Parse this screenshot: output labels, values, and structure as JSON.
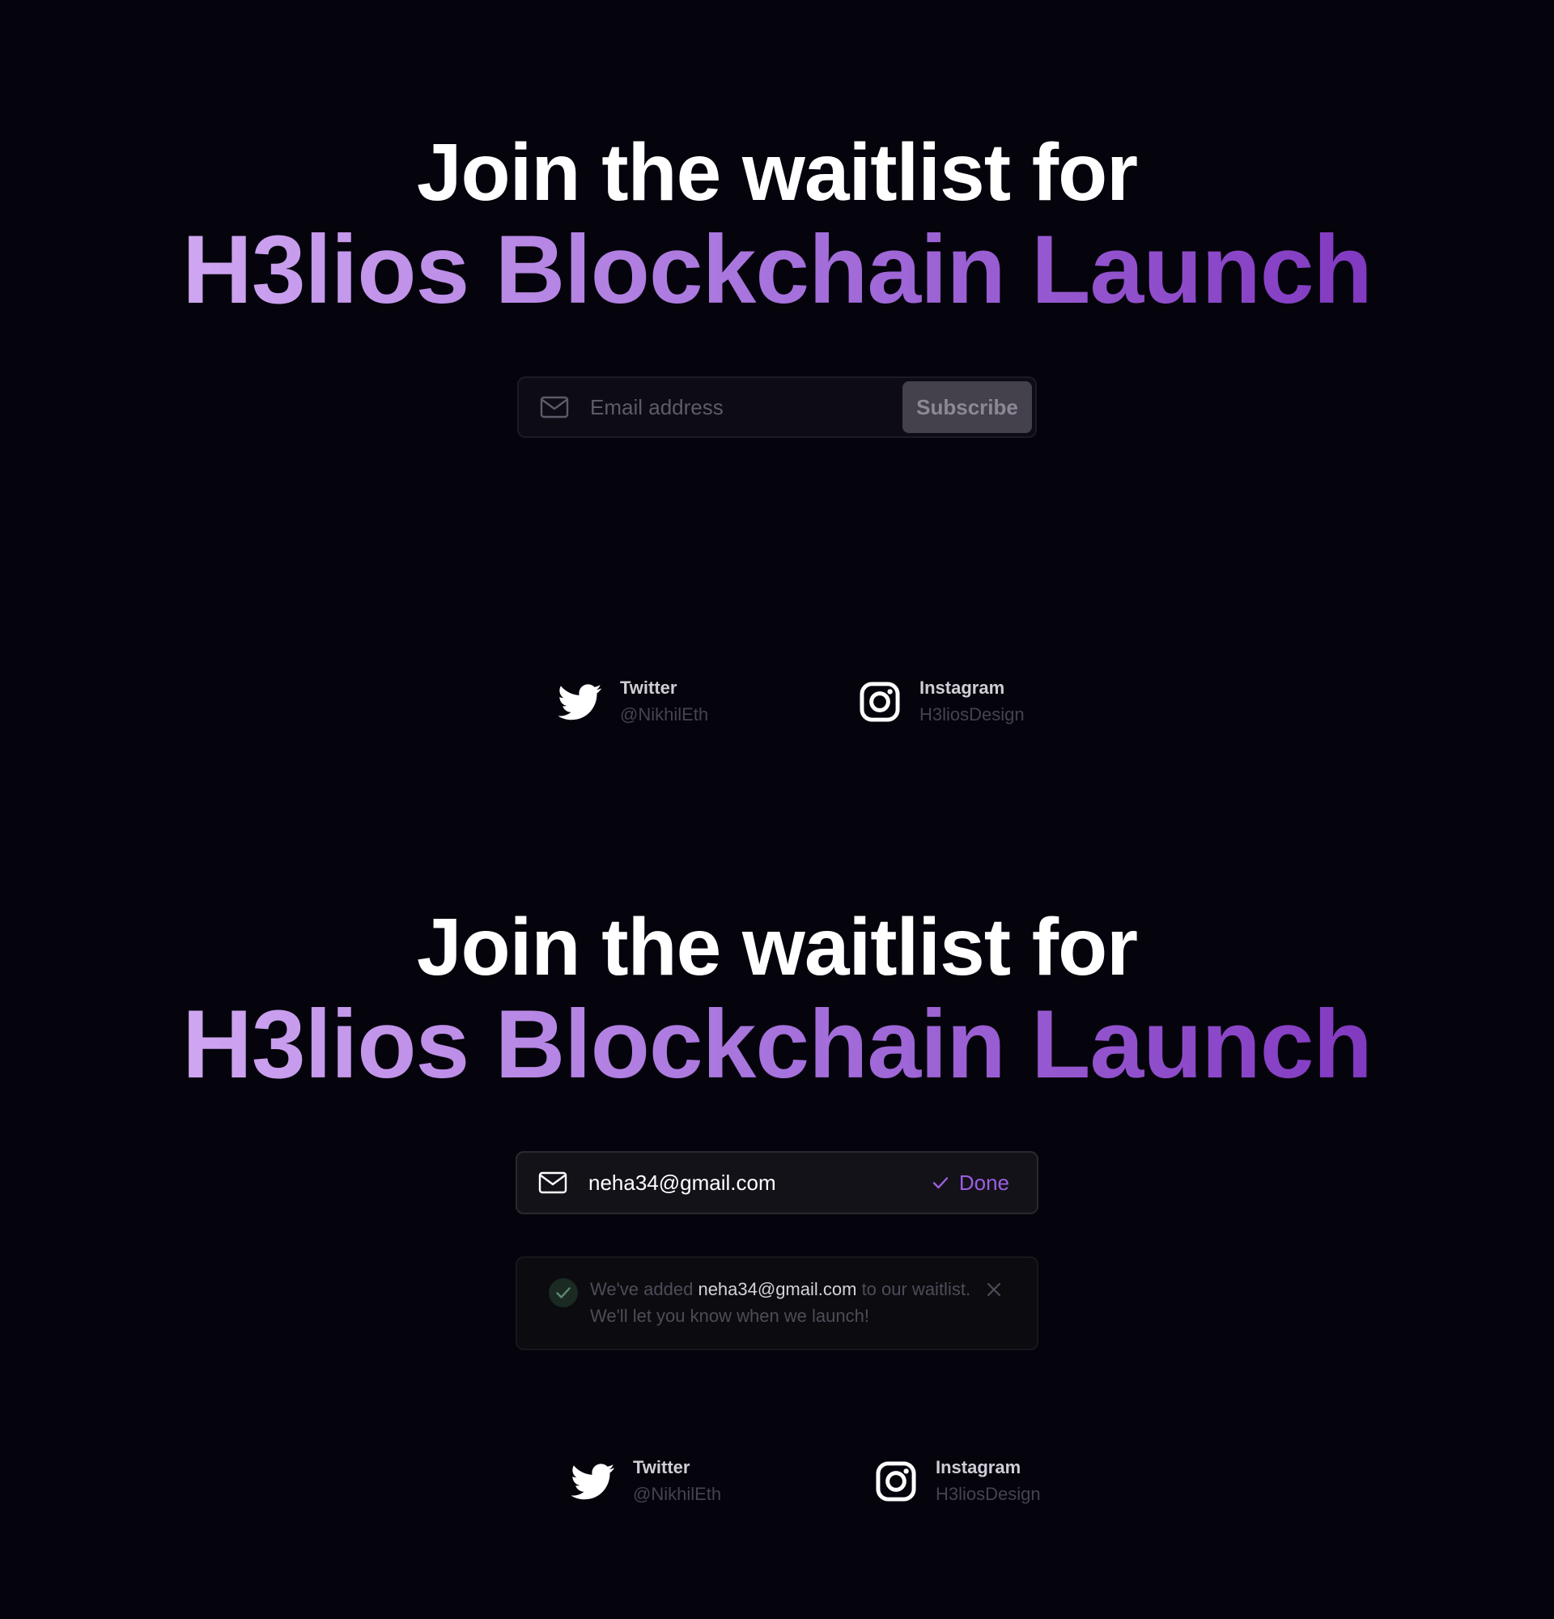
{
  "hero": {
    "line1": "Join the waitlist for",
    "line2": "H3lios Blockchain Launch"
  },
  "form_empty": {
    "placeholder": "Email address",
    "button_label": "Subscribe"
  },
  "form_done": {
    "email_value": "neha34@gmail.com",
    "button_label": "Done"
  },
  "toast": {
    "prefix": "We've added ",
    "email": "neha34@gmail.com",
    "suffix": " to our waitlist. We'll let you know when we launch!"
  },
  "socials": [
    {
      "name": "Twitter",
      "handle": "@NikhilEth",
      "icon": "twitter-bird-icon"
    },
    {
      "name": "Instagram",
      "handle": "H3liosDesign",
      "icon": "instagram-icon"
    }
  ],
  "colors": {
    "background": "#05040c",
    "gradient_start": "#dcb6f7",
    "gradient_end": "#7627b8",
    "accent": "#9b5fe0",
    "subscribe_bg": "#44404c"
  }
}
